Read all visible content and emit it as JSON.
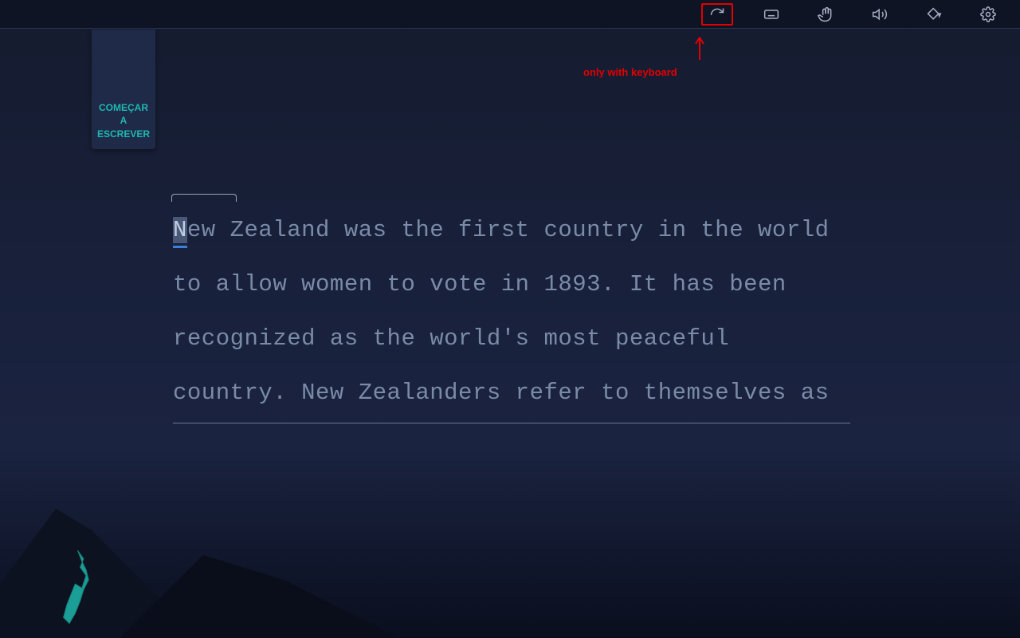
{
  "toolbar": {
    "icons": [
      "redo",
      "keyboard",
      "hand",
      "volume",
      "paint",
      "settings"
    ]
  },
  "annotation": {
    "text": "only with keyboard"
  },
  "bookmark": {
    "label": "COMEÇAR\nA\nESCREVER"
  },
  "typing": {
    "current_char": "N",
    "rest_text": "ew Zealand was the first country in the world to allow women to vote in 1893. It has been recognized as the world's most peaceful country. New Zealanders refer to themselves as"
  },
  "colors": {
    "accent": "#1fb8b0",
    "highlight_red": "#e20000",
    "text_dim": "#7a8ba8"
  }
}
